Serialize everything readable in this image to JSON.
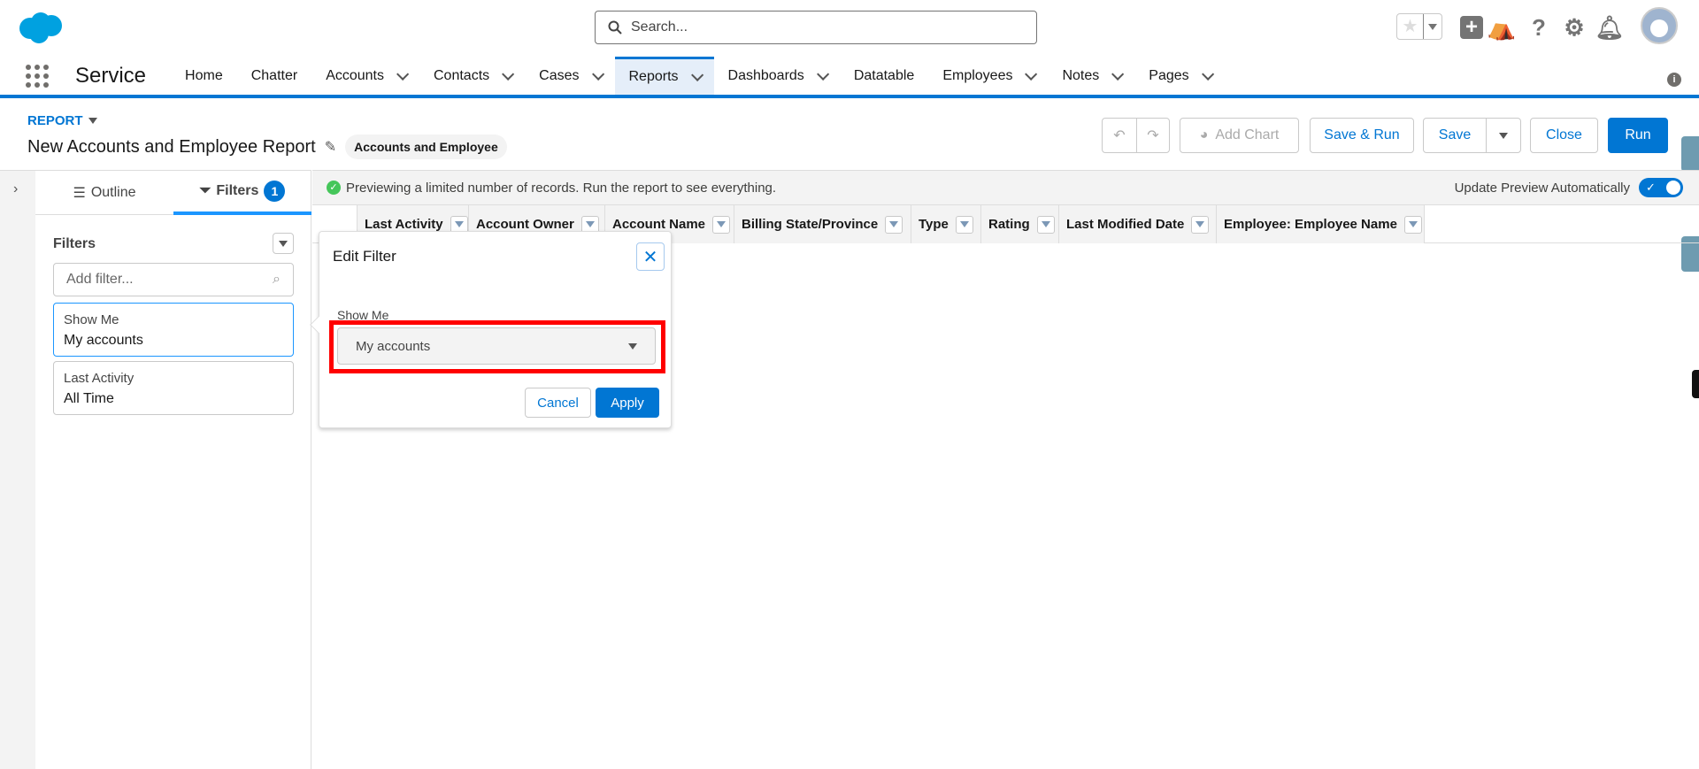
{
  "header": {
    "search_placeholder": "Search...",
    "icons": [
      "salesforce-logo",
      "star-icon",
      "add-icon",
      "trailhead-icon",
      "help-icon",
      "gear-icon",
      "bell-icon",
      "avatar"
    ]
  },
  "nav": {
    "app_name": "Service",
    "items": [
      {
        "label": "Home",
        "dropdown": false
      },
      {
        "label": "Chatter",
        "dropdown": false
      },
      {
        "label": "Accounts",
        "dropdown": true
      },
      {
        "label": "Contacts",
        "dropdown": true
      },
      {
        "label": "Cases",
        "dropdown": true
      },
      {
        "label": "Reports",
        "dropdown": true,
        "active": true
      },
      {
        "label": "Dashboards",
        "dropdown": true
      },
      {
        "label": "Datatable",
        "dropdown": false
      },
      {
        "label": "Employees",
        "dropdown": true
      },
      {
        "label": "Notes",
        "dropdown": true
      },
      {
        "label": "Pages",
        "dropdown": true
      }
    ]
  },
  "report": {
    "type_label": "REPORT",
    "title": "New Accounts and Employee Report",
    "report_type_badge": "Accounts and Employee"
  },
  "toolbar": {
    "add_chart": "Add Chart",
    "save_run": "Save & Run",
    "save": "Save",
    "close": "Close",
    "run": "Run"
  },
  "panel": {
    "tab_outline": "Outline",
    "tab_filters": "Filters",
    "filters_count": "1",
    "filters_heading": "Filters",
    "add_filter_placeholder": "Add filter...",
    "filters": [
      {
        "label": "Show Me",
        "value": "My accounts"
      },
      {
        "label": "Last Activity",
        "value": "All Time"
      }
    ]
  },
  "preview": {
    "message": "Previewing a limited number of records. Run the report to see everything.",
    "auto_update_label": "Update Preview Automatically",
    "auto_update": true
  },
  "columns": [
    "Last Activity",
    "Account Owner",
    "Account Name",
    "Billing State/Province",
    "Type",
    "Rating",
    "Last Modified Date",
    "Employee: Employee Name"
  ],
  "edit_filter": {
    "title": "Edit Filter",
    "field_label": "Show Me",
    "selected": "My accounts",
    "cancel": "Cancel",
    "apply": "Apply"
  },
  "colors": {
    "brand": "#0176d3",
    "highlight": "#ff0000",
    "success": "#2e844a"
  }
}
